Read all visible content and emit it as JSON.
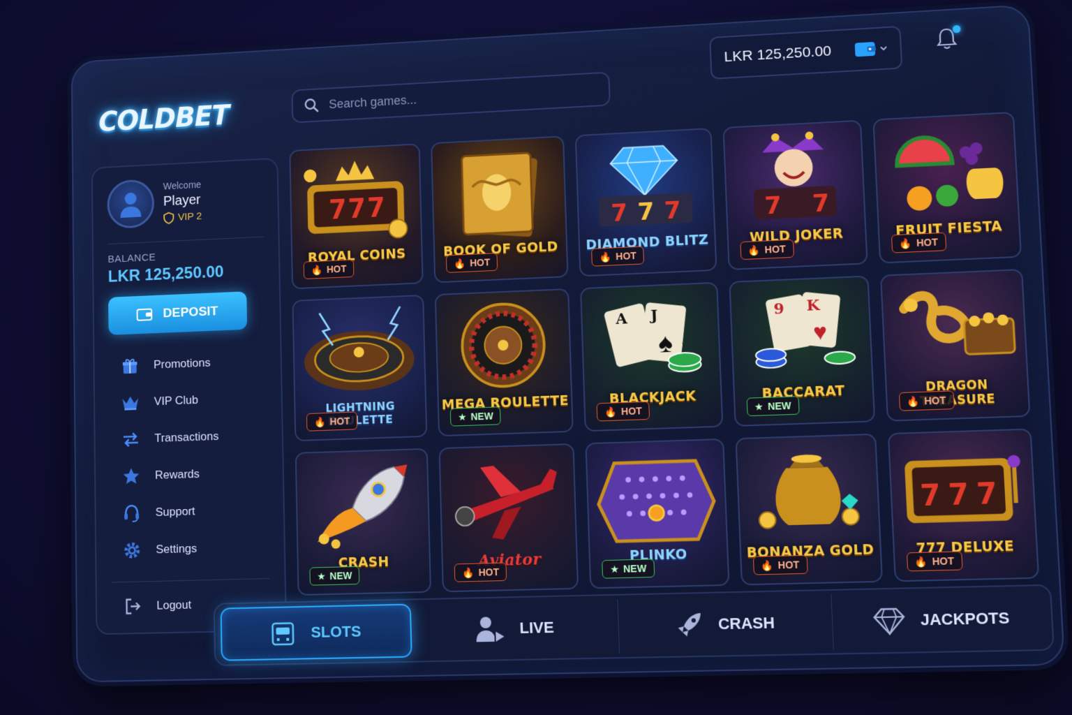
{
  "brand": {
    "logo_text": "COLDBET"
  },
  "search": {
    "placeholder": "Search games..."
  },
  "header": {
    "balance": "LKR 125,250.00"
  },
  "profile": {
    "welcome": "Welcome",
    "name": "Player",
    "vip": "VIP 2",
    "balance_label": "BALANCE",
    "balance_value": "LKR 125,250.00",
    "deposit_label": "DEPOSIT"
  },
  "menu": {
    "items": [
      {
        "label": "Promotions",
        "icon": "gift-icon"
      },
      {
        "label": "VIP Club",
        "icon": "crown-icon"
      },
      {
        "label": "Transactions",
        "icon": "transfer-arrows-icon"
      },
      {
        "label": "Rewards",
        "icon": "star-icon"
      },
      {
        "label": "Support",
        "icon": "headset-icon"
      },
      {
        "label": "Settings",
        "icon": "gear-icon"
      }
    ],
    "logout": "Logout"
  },
  "games": [
    {
      "title": "ROYAL COINS",
      "badge": "HOT",
      "art": "slot"
    },
    {
      "title": "BOOK OF GOLD",
      "badge": "HOT",
      "art": "book"
    },
    {
      "title": "DIAMOND BLITZ",
      "badge": "HOT",
      "art": "diamond"
    },
    {
      "title": "WILD JOKER",
      "badge": "HOT",
      "art": "joker"
    },
    {
      "title": "FRUIT FIESTA",
      "badge": "HOT",
      "art": "fruit"
    },
    {
      "title": "LIGHTNING ROULETTE",
      "badge": "HOT",
      "art": "roulette"
    },
    {
      "title": "MEGA ROULETTE",
      "badge": "NEW",
      "art": "roulette"
    },
    {
      "title": "BLACKJACK",
      "badge": "HOT",
      "art": "cards"
    },
    {
      "title": "BACCARAT",
      "badge": "NEW",
      "art": "cards"
    },
    {
      "title": "DRAGON TREASURE",
      "badge": "HOT",
      "art": "dragon"
    },
    {
      "title": "CRASH",
      "badge": "NEW",
      "art": "rocket"
    },
    {
      "title": "Aviator",
      "badge": "HOT",
      "art": "plane"
    },
    {
      "title": "PLINKO",
      "badge": "NEW",
      "art": "plinko"
    },
    {
      "title": "BONANZA GOLD",
      "badge": "HOT",
      "art": "gold"
    },
    {
      "title": "777 DELUXE",
      "badge": "HOT",
      "art": "slot"
    }
  ],
  "tabs": [
    {
      "label": "SLOTS",
      "icon": "slot-machine-icon",
      "active": true
    },
    {
      "label": "LIVE",
      "icon": "live-dealer-icon",
      "active": false
    },
    {
      "label": "CRASH",
      "icon": "rocket-icon",
      "active": false
    },
    {
      "label": "JACKPOTS",
      "icon": "diamond-icon",
      "active": false
    }
  ],
  "colors": {
    "accent": "#34b6ff",
    "gold": "#f7c948",
    "hot": "#e2582b",
    "new": "#3fbf5a"
  }
}
